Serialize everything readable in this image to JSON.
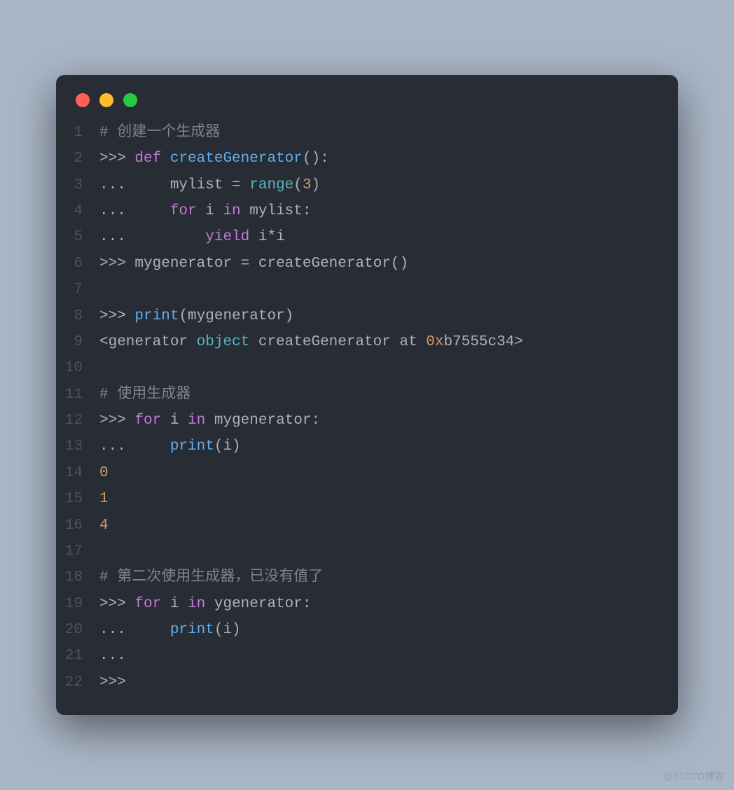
{
  "watermark": "@51CTO博客",
  "lines": [
    {
      "n": "1",
      "tokens": [
        {
          "t": "# 创建一个生成器",
          "c": "c-comment"
        }
      ]
    },
    {
      "n": "2",
      "tokens": [
        {
          "t": ">>> ",
          "c": "c-prompt"
        },
        {
          "t": "def",
          "c": "c-key"
        },
        {
          "t": " ",
          "c": "c-op"
        },
        {
          "t": "createGenerator",
          "c": "c-def"
        },
        {
          "t": "():",
          "c": "c-op"
        }
      ]
    },
    {
      "n": "3",
      "tokens": [
        {
          "t": "...     mylist ",
          "c": "c-prompt"
        },
        {
          "t": "=",
          "c": "c-op"
        },
        {
          "t": " ",
          "c": "c-op"
        },
        {
          "t": "range",
          "c": "c-builtin"
        },
        {
          "t": "(",
          "c": "c-op"
        },
        {
          "t": "3",
          "c": "c-num"
        },
        {
          "t": ")",
          "c": "c-op"
        }
      ]
    },
    {
      "n": "4",
      "tokens": [
        {
          "t": "...     ",
          "c": "c-prompt"
        },
        {
          "t": "for",
          "c": "c-key"
        },
        {
          "t": " i ",
          "c": "c-id"
        },
        {
          "t": "in",
          "c": "c-key"
        },
        {
          "t": " mylist:",
          "c": "c-id"
        }
      ]
    },
    {
      "n": "5",
      "tokens": [
        {
          "t": "...         ",
          "c": "c-prompt"
        },
        {
          "t": "yield",
          "c": "c-key"
        },
        {
          "t": " i",
          "c": "c-id"
        },
        {
          "t": "*",
          "c": "c-op"
        },
        {
          "t": "i",
          "c": "c-id"
        }
      ]
    },
    {
      "n": "6",
      "tokens": [
        {
          "t": ">>> ",
          "c": "c-prompt"
        },
        {
          "t": "mygenerator ",
          "c": "c-id"
        },
        {
          "t": "=",
          "c": "c-op"
        },
        {
          "t": " createGenerator()",
          "c": "c-id"
        }
      ]
    },
    {
      "n": "7",
      "tokens": [
        {
          "t": "",
          "c": "c-id"
        }
      ]
    },
    {
      "n": "8",
      "tokens": [
        {
          "t": ">>> ",
          "c": "c-prompt"
        },
        {
          "t": "print",
          "c": "c-fn"
        },
        {
          "t": "(mygenerator)",
          "c": "c-id"
        }
      ]
    },
    {
      "n": "9",
      "tokens": [
        {
          "t": "<generator ",
          "c": "c-id"
        },
        {
          "t": "object",
          "c": "c-obj"
        },
        {
          "t": " createGenerator at ",
          "c": "c-id"
        },
        {
          "t": "0x",
          "c": "c-num"
        },
        {
          "t": "b7555c34",
          "c": "c-id"
        },
        {
          "t": ">",
          "c": "c-id"
        }
      ]
    },
    {
      "n": "10",
      "tokens": [
        {
          "t": "",
          "c": "c-id"
        }
      ]
    },
    {
      "n": "11",
      "tokens": [
        {
          "t": "# 使用生成器",
          "c": "c-comment"
        }
      ]
    },
    {
      "n": "12",
      "tokens": [
        {
          "t": ">>> ",
          "c": "c-prompt"
        },
        {
          "t": "for",
          "c": "c-key"
        },
        {
          "t": " i ",
          "c": "c-id"
        },
        {
          "t": "in",
          "c": "c-key"
        },
        {
          "t": " mygenerator:",
          "c": "c-id"
        }
      ]
    },
    {
      "n": "13",
      "tokens": [
        {
          "t": "...     ",
          "c": "c-prompt"
        },
        {
          "t": "print",
          "c": "c-fn"
        },
        {
          "t": "(i)",
          "c": "c-id"
        }
      ]
    },
    {
      "n": "14",
      "tokens": [
        {
          "t": "0",
          "c": "c-num"
        }
      ]
    },
    {
      "n": "15",
      "tokens": [
        {
          "t": "1",
          "c": "c-num"
        }
      ]
    },
    {
      "n": "16",
      "tokens": [
        {
          "t": "4",
          "c": "c-num"
        }
      ]
    },
    {
      "n": "17",
      "tokens": [
        {
          "t": "",
          "c": "c-id"
        }
      ]
    },
    {
      "n": "18",
      "tokens": [
        {
          "t": "# 第二次使用生成器，已没有值了",
          "c": "c-comment"
        }
      ]
    },
    {
      "n": "19",
      "tokens": [
        {
          "t": ">>> ",
          "c": "c-prompt"
        },
        {
          "t": "for",
          "c": "c-key"
        },
        {
          "t": " i ",
          "c": "c-id"
        },
        {
          "t": "in",
          "c": "c-key"
        },
        {
          "t": " ygenerator:",
          "c": "c-id"
        }
      ]
    },
    {
      "n": "20",
      "tokens": [
        {
          "t": "...     ",
          "c": "c-prompt"
        },
        {
          "t": "print",
          "c": "c-fn"
        },
        {
          "t": "(i)",
          "c": "c-id"
        }
      ]
    },
    {
      "n": "21",
      "tokens": [
        {
          "t": "...",
          "c": "c-prompt"
        }
      ]
    },
    {
      "n": "22",
      "tokens": [
        {
          "t": ">>>",
          "c": "c-prompt"
        }
      ]
    }
  ]
}
